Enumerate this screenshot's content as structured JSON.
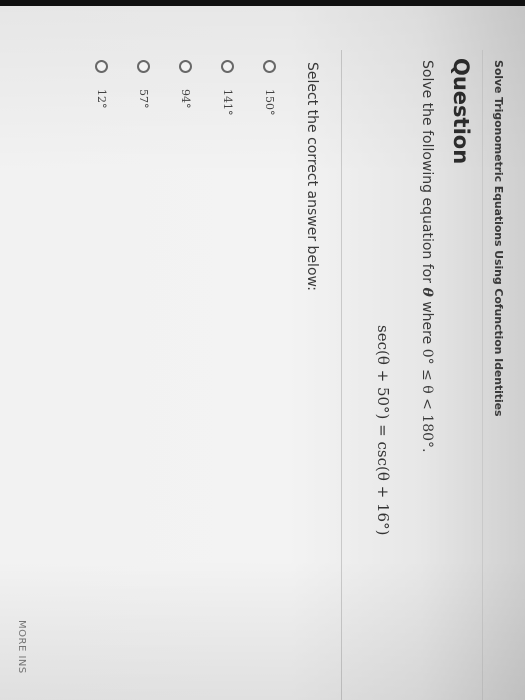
{
  "topic": "Solve Trigonometric Equations Using Cofunction Identities",
  "question": {
    "heading": "Question",
    "text_before": "Solve the following equation for ",
    "variable": "θ",
    "text_where": " where ",
    "range": "0° ≤ θ < 180°.",
    "equation": "sec(θ + 50°) = csc(θ + 16°)"
  },
  "answer": {
    "prompt": "Select the correct answer below:",
    "options": [
      {
        "label": "150°"
      },
      {
        "label": "141°"
      },
      {
        "label": "94°"
      },
      {
        "label": "57°"
      },
      {
        "label": "12°"
      }
    ]
  },
  "footer": {
    "more": "MORE INS"
  },
  "colors": {
    "background": "#f2f2f2",
    "text": "#333333",
    "radio_border": "#6b6b6b"
  }
}
